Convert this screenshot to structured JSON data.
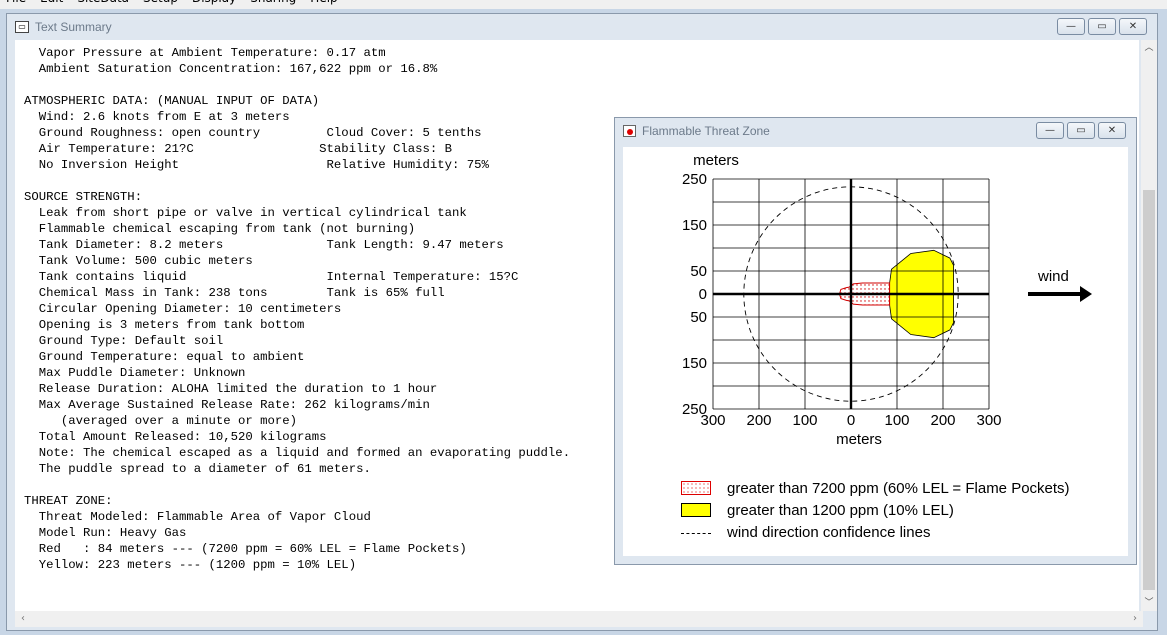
{
  "menubar": {
    "items": [
      "File",
      "Edit",
      "SiteData",
      "Setup",
      "Display",
      "Sharing",
      "Help"
    ]
  },
  "summary_window": {
    "title": "Text Summary",
    "controls": {
      "minimize": "—",
      "maximize": "▭",
      "close": "✕"
    },
    "lines": [
      "  Vapor Pressure at Ambient Temperature: 0.17 atm",
      "  Ambient Saturation Concentration: 167,622 ppm or 16.8%",
      "",
      "ATMOSPHERIC DATA: (MANUAL INPUT OF DATA)",
      "  Wind: 2.6 knots from E at 3 meters",
      "  Ground Roughness: open country         Cloud Cover: 5 tenths",
      "  Air Temperature: 21?C                 Stability Class: B",
      "  No Inversion Height                    Relative Humidity: 75%",
      "",
      "SOURCE STRENGTH:",
      "  Leak from short pipe or valve in vertical cylindrical tank",
      "  Flammable chemical escaping from tank (not burning)",
      "  Tank Diameter: 8.2 meters              Tank Length: 9.47 meters",
      "  Tank Volume: 500 cubic meters",
      "  Tank contains liquid                   Internal Temperature: 15?C",
      "  Chemical Mass in Tank: 238 tons        Tank is 65% full",
      "  Circular Opening Diameter: 10 centimeters",
      "  Opening is 3 meters from tank bottom",
      "  Ground Type: Default soil",
      "  Ground Temperature: equal to ambient",
      "  Max Puddle Diameter: Unknown",
      "  Release Duration: ALOHA limited the duration to 1 hour",
      "  Max Average Sustained Release Rate: 262 kilograms/min",
      "     (averaged over a minute or more)",
      "  Total Amount Released: 10,520 kilograms",
      "  Note: The chemical escaped as a liquid and formed an evaporating puddle.",
      "  The puddle spread to a diameter of 61 meters.",
      "",
      "THREAT ZONE:",
      "  Threat Modeled: Flammable Area of Vapor Cloud",
      "  Model Run: Heavy Gas",
      "  Red   : 84 meters --- (7200 ppm = 60% LEL = Flame Pockets)",
      "  Yellow: 223 meters --- (1200 ppm = 10% LEL)"
    ]
  },
  "threat_window": {
    "title": "Flammable Threat Zone",
    "controls": {
      "minimize": "—",
      "maximize": "▭",
      "close": "✕"
    },
    "wind_label": "wind",
    "legend": {
      "red": "greater than 7200 ppm (60% LEL = Flame Pockets)",
      "yellow": "greater than 1200 ppm (10% LEL)",
      "dashed": "wind direction confidence lines"
    },
    "colors": {
      "red_zone": "#d00000",
      "yellow_zone": "#ffff00"
    }
  },
  "chart_data": {
    "type": "area",
    "ylabel": "meters",
    "xlabel": "meters",
    "x_ticks": [
      "300",
      "200",
      "100",
      "0",
      "100",
      "200",
      "300"
    ],
    "x_tick_values": [
      -300,
      -200,
      -100,
      0,
      100,
      200,
      300
    ],
    "y_ticks": [
      "250",
      "150",
      "50",
      "0",
      "50",
      "150",
      "250"
    ],
    "y_tick_values": [
      250,
      150,
      50,
      0,
      -50,
      -150,
      -250
    ],
    "xlim": [
      -300,
      300
    ],
    "ylim": [
      -250,
      250
    ],
    "grid": true,
    "zones": [
      {
        "name": "greater than 7200 ppm (60% LEL = Flame Pockets)",
        "color": "#d00000",
        "max_distance_m": 84,
        "outline": [
          [
            -25,
            0
          ],
          [
            -22,
            10
          ],
          [
            -10,
            14
          ],
          [
            -4,
            15
          ],
          [
            5,
            22
          ],
          [
            25,
            24
          ],
          [
            84,
            24
          ],
          [
            84,
            -24
          ],
          [
            25,
            -24
          ],
          [
            5,
            -22
          ],
          [
            -4,
            -15
          ],
          [
            -10,
            -14
          ],
          [
            -22,
            -10
          ]
        ]
      },
      {
        "name": "greater than 1200 ppm (10% LEL)",
        "color": "#ffff00",
        "max_distance_m": 223,
        "outline": [
          [
            84,
            24
          ],
          [
            88,
            54
          ],
          [
            130,
            88
          ],
          [
            180,
            95
          ],
          [
            215,
            78
          ],
          [
            223,
            62
          ],
          [
            223,
            -62
          ],
          [
            215,
            -78
          ],
          [
            180,
            -95
          ],
          [
            130,
            -88
          ],
          [
            88,
            -54
          ],
          [
            84,
            -24
          ]
        ]
      }
    ],
    "confidence_line_radius_m": 233,
    "wind_direction": "from E"
  }
}
